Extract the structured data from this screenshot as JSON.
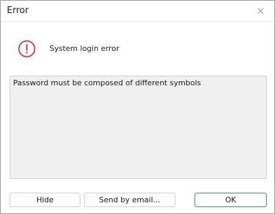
{
  "window": {
    "title": "Error"
  },
  "icons": {
    "close": "close-icon",
    "error": "error-icon",
    "error_color": "#d6454a"
  },
  "message": "System login error",
  "details": "Password must be composed of different symbols",
  "buttons": {
    "hide": "Hide",
    "send_email": "Send by email...",
    "ok": "OK"
  },
  "colors": {
    "accent": "#3c7fd1"
  }
}
